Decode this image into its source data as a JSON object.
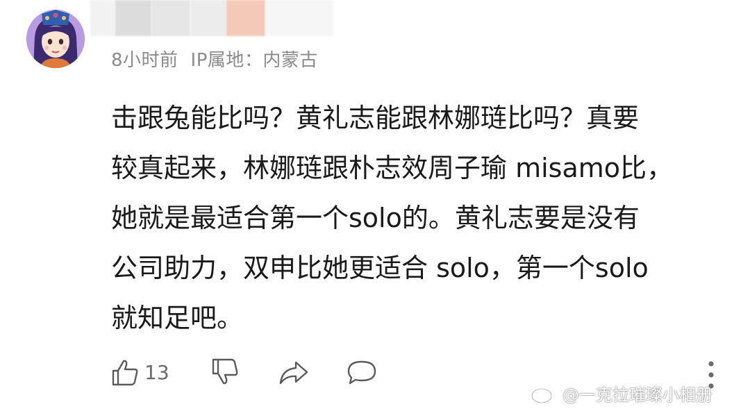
{
  "header": {
    "time": "8小时前",
    "ip_location": "IP属地：内蒙古"
  },
  "comment": {
    "lines": [
      "击跟兔能比吗？黄礼志能跟林娜琏比吗？真要",
      "较真起来，林娜琏跟朴志效周子瑜 misamo比，",
      "她就是最适合第一个solo的。黄礼志要是没有",
      "公司助力，双申比她更适合 solo，第一个solo",
      "就知足吧。"
    ]
  },
  "actions": {
    "like_count": "13",
    "icons": [
      "thumbs-up-icon",
      "thumbs-down-icon",
      "share-icon",
      "comment-icon",
      "more-icon"
    ]
  },
  "watermark": {
    "text": "@一克拉璀璨小相册",
    "icon": "weibo-logo"
  },
  "colors": {
    "text": "#1a1a1a",
    "meta": "#8a8a8a",
    "icon": "#5a5a5a",
    "avatar_bg": "#b89be0"
  }
}
